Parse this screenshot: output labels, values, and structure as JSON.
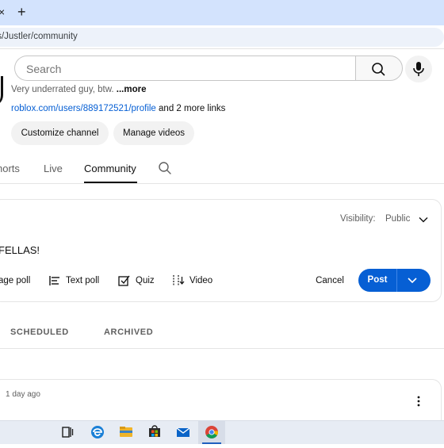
{
  "browser": {
    "tab_close_glyph": "×",
    "new_tab_glyph": "+",
    "url": "ts/Justler/community"
  },
  "header": {
    "search_placeholder": "Search",
    "search_icon": "search-icon",
    "mic_icon": "microphone-icon"
  },
  "channel": {
    "description": "Very underrated guy, btw. ",
    "description_more": "...more",
    "profile_link": "roblox.com/users/889172521/profile",
    "more_links": " and 2 more links",
    "customize_label": "Customize channel",
    "manage_label": "Manage videos"
  },
  "tabs": {
    "shorts": "horts",
    "live": "Live",
    "community": "Community",
    "active": "Community"
  },
  "composer": {
    "visibility_label": "Visibility:",
    "visibility_value": "Public",
    "text": "FELLAS!",
    "tools": {
      "image_poll": "age poll",
      "text_poll": "Text poll",
      "quiz": "Quiz",
      "video": "Video"
    },
    "cancel_label": "Cancel",
    "post_label": "Post"
  },
  "subtabs": {
    "scheduled": "SCHEDULED",
    "archived": "ARCHIVED"
  },
  "post": {
    "time": "1 day ago"
  },
  "colors": {
    "brand_blue": "#065fd4",
    "tabstrip": "#d3e3fd",
    "taskbar": "#e7ecf4"
  },
  "taskbar": {
    "items": [
      "task-view-icon",
      "edge-icon",
      "file-explorer-icon",
      "store-icon",
      "mail-icon",
      "chrome-icon"
    ],
    "active": "chrome-icon"
  }
}
